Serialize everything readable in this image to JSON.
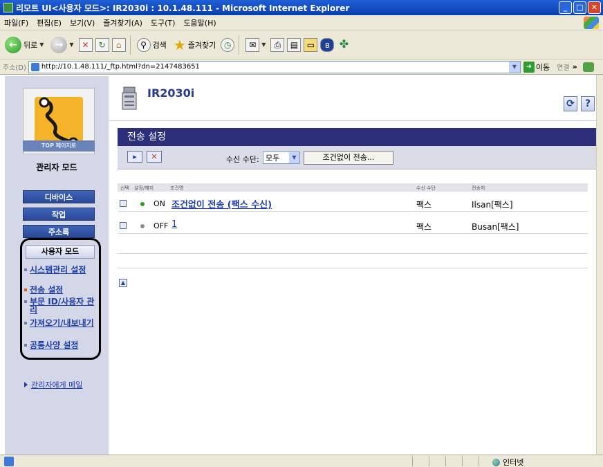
{
  "window": {
    "title": "리모트 UI<사용자 모드>: IR2030i : 10.1.48.111 - Microsoft Internet Explorer",
    "buttons": {
      "minimize": "_",
      "maximize": "□",
      "close": "✕"
    }
  },
  "menu": [
    "파일(F)",
    "편집(E)",
    "보기(V)",
    "즐겨찾기(A)",
    "도구(T)",
    "도움말(H)"
  ],
  "toolbar": {
    "back_label": "뒤로",
    "search_label": "검색",
    "favorites_label": "즐겨찾기"
  },
  "address": {
    "label": "주소(D)",
    "url": "http://10.1.48.111/_ftp.html?dn=2147483651",
    "go_label": "이동",
    "links_label": "연결",
    "chevron": "»"
  },
  "sidebar": {
    "top_page_label": "TOP 페이지로",
    "admin_mode_label": "관리자 모드",
    "nav": [
      "디바이스",
      "작업",
      "주소록"
    ],
    "user_mode_label": "사용자 모드",
    "links": [
      {
        "label": "시스템관리 설정",
        "active": false
      },
      {
        "label": "전송 설정",
        "active": true
      },
      {
        "label": "부문 ID/사용자 관리",
        "active": false
      },
      {
        "label": "가져오기/내보내기",
        "active": false
      },
      {
        "label": "공통사양 설정",
        "active": false
      }
    ],
    "mail_link": "관리자에게 메일"
  },
  "header": {
    "device_name": "IR2030i",
    "refresh_icon": "refresh-icon",
    "help_icon": "help-icon"
  },
  "section": {
    "title": "전송 설정",
    "filter_label": "수신 수단:",
    "filter_value": "모두",
    "forward_button": "조건없이 전송..."
  },
  "table": {
    "columns": [
      "선택",
      "설정/해지",
      "조건명",
      "수신 수단",
      "전송처"
    ],
    "rows": [
      {
        "state": "ON",
        "state_color": "#2d9a2d",
        "name": "조건없이 전송 (팩스 수신)",
        "method": "팩스",
        "destination": "Ilsan[팩스]"
      },
      {
        "state": "OFF",
        "state_color": "#8a8a8a",
        "name": "1",
        "method": "팩스",
        "destination": "Busan[팩스]"
      }
    ]
  },
  "status": {
    "zone": "인터넷"
  }
}
